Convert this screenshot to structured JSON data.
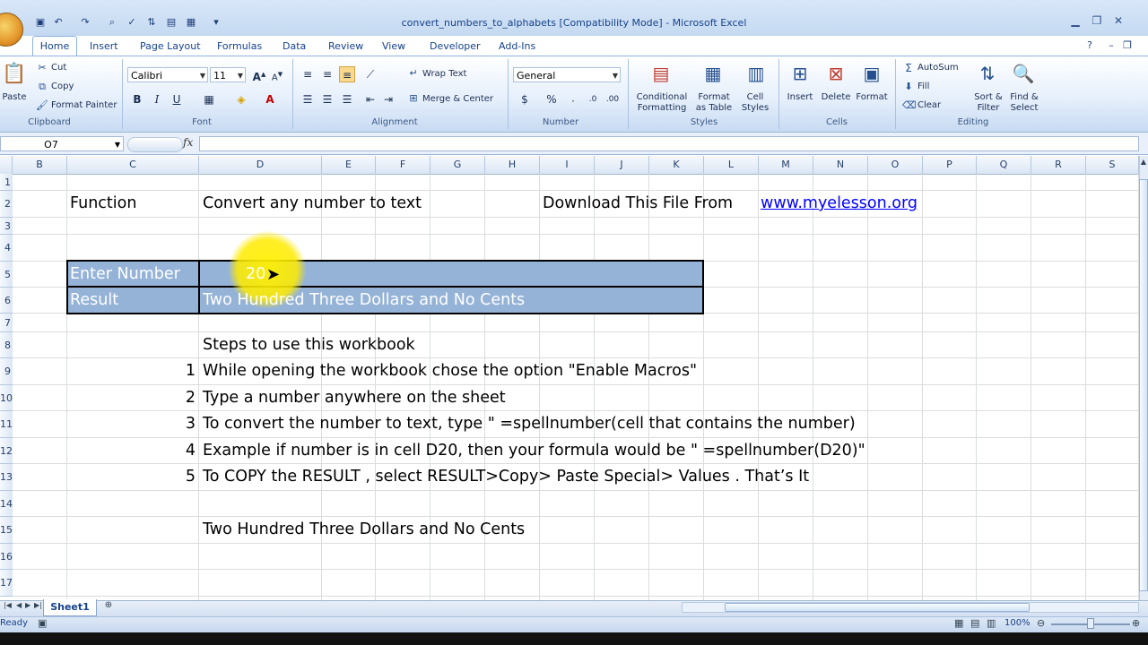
{
  "window": {
    "title": "convert_numbers_to_alphabets  [Compatibility Mode] - Microsoft Excel"
  },
  "tabs": [
    "Home",
    "Insert",
    "Page Layout",
    "Formulas",
    "Data",
    "Review",
    "View",
    "Developer",
    "Add-Ins"
  ],
  "ribbon": {
    "clipboard": {
      "paste": "Paste",
      "cut": "Cut",
      "copy": "Copy",
      "format_painter": "Format Painter",
      "label": "Clipboard"
    },
    "font": {
      "name": "Calibri",
      "size": "11",
      "label": "Font",
      "bold": "B",
      "italic": "I",
      "underline": "U"
    },
    "alignment": {
      "wrap_text": "Wrap Text",
      "merge_center": "Merge & Center",
      "label": "Alignment"
    },
    "number": {
      "format": "General",
      "label": "Number",
      "currency": "$",
      "percent": "%"
    },
    "styles": {
      "conditional": "Conditional",
      "conditional2": "Formatting",
      "format_as": "Format",
      "format_as2": "as Table",
      "cell": "Cell",
      "cell2": "Styles",
      "label": "Styles"
    },
    "cells": {
      "insert": "Insert",
      "delete": "Delete",
      "format": "Format",
      "label": "Cells"
    },
    "editing": {
      "autosum": "AutoSum",
      "fill": "Fill",
      "clear": "Clear",
      "sort": "Sort &",
      "sort2": "Filter",
      "find": "Find &",
      "find2": "Select",
      "label": "Editing"
    }
  },
  "formula_bar": {
    "name_box": "O7",
    "fx": "fx",
    "value": ""
  },
  "columns": [
    "B",
    "C",
    "D",
    "E",
    "F",
    "G",
    "H",
    "I",
    "J",
    "K",
    "L",
    "M",
    "N",
    "O",
    "P",
    "Q",
    "R",
    "S"
  ],
  "rows": [
    "1",
    "2",
    "3",
    "4",
    "5",
    "6",
    "7",
    "8",
    "9",
    "10",
    "11",
    "12",
    "13",
    "14",
    "15",
    "16",
    "17"
  ],
  "cells": {
    "c2": "Function",
    "d2": "Convert any number to text",
    "i2": "Download This File From",
    "m2": "www.myelesson.org",
    "c5": "Enter Number",
    "d5": "20",
    "c6": "Result",
    "d6": "Two Hundred Three Dollars and No Cents",
    "d8": "Steps to use this workbook",
    "c9": "1",
    "d9": "While opening the workbook chose the option \"Enable Macros\"",
    "c10": "2",
    "d10": "Type a number anywhere on the sheet",
    "c11": "3",
    "d11": "To convert the number to text, type \" =spellnumber(cell that contains the number)",
    "c12": "4",
    "d12": "Example if number is in cell D20, then your formula would be \" =spellnumber(D20)\"",
    "c13": "5",
    "d13": "To COPY the RESULT , select RESULT>Copy> Paste Special> Values . That’s It",
    "d15": "Two Hundred Three Dollars and No Cents"
  },
  "sheet": {
    "tab": "Sheet1"
  },
  "status": {
    "state": "Ready",
    "zoom": "100%"
  },
  "colors": {
    "highlight": "#95b3d7",
    "link": "#0000ff",
    "cursor_glow": "#fff200"
  }
}
